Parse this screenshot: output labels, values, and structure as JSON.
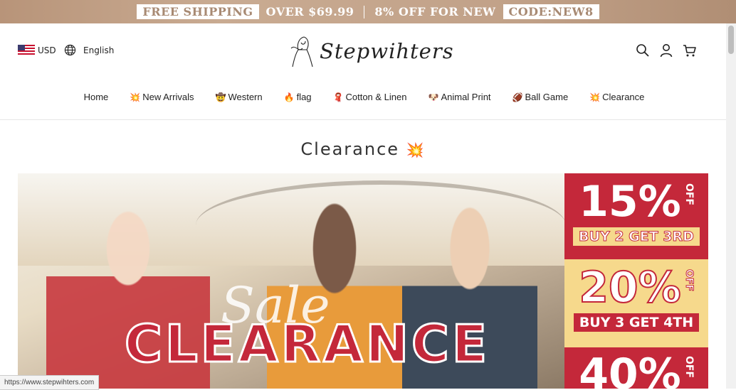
{
  "promo": {
    "free_shipping": "FREE SHIPPING",
    "over": "OVER $69.99",
    "discount": "8% OFF FOR NEW",
    "code": "CODE:NEW8"
  },
  "header": {
    "currency": "USD",
    "language": "English",
    "logo_text": "Stepwihters",
    "icons": [
      "search-icon",
      "account-icon",
      "cart-icon"
    ]
  },
  "nav": [
    {
      "label": "Home",
      "emoji": ""
    },
    {
      "label": "New Arrivals",
      "emoji": "💥"
    },
    {
      "label": "Western",
      "emoji": "🤠"
    },
    {
      "label": "flag",
      "emoji": "🔥"
    },
    {
      "label": "Cotton & Linen",
      "emoji": "🧣"
    },
    {
      "label": "Animal Print",
      "emoji": "🐶"
    },
    {
      "label": "Ball Game",
      "emoji": "🏈"
    },
    {
      "label": "Clearance",
      "emoji": "💥"
    }
  ],
  "page": {
    "title": "Clearance",
    "title_emoji": "💥"
  },
  "banner": {
    "script_text": "Sale",
    "headline": "CLEARANCE",
    "offers": [
      {
        "pct": "15%",
        "off": "OFF",
        "deal": "BUY 2 GET 3RD"
      },
      {
        "pct": "20%",
        "off": "OFF",
        "deal": "BUY 3 GET 4TH"
      },
      {
        "pct": "40%",
        "off": "OFF",
        "deal": ""
      }
    ]
  },
  "status_bar": {
    "url": "https://www.stepwihters.com"
  }
}
